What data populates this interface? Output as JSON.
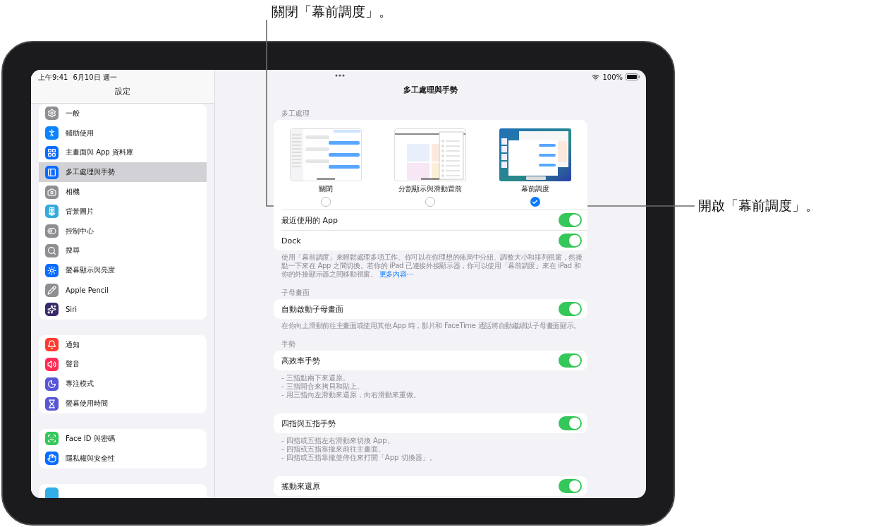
{
  "callouts": [
    {
      "text": "關閉「幕前調度」。"
    },
    {
      "text": "開啟「幕前調度」。"
    }
  ],
  "status_bar": {
    "time": "上午9:41",
    "date": "6月10日 週一",
    "battery": "100%"
  },
  "sidebar": {
    "title": "設定",
    "groups": [
      [
        {
          "label": "一般",
          "kind": "gear",
          "color": "#8e8e93",
          "selected": false
        },
        {
          "label": "輔助使用",
          "kind": "accessibility",
          "color": "#0a84ff",
          "selected": false
        },
        {
          "label": "主畫面與 App 資料庫",
          "kind": "grid",
          "color": "#0a6cff",
          "selected": false
        },
        {
          "label": "多工處理與手勢",
          "kind": "panels",
          "color": "#0a6cff",
          "selected": true
        },
        {
          "label": "相機",
          "kind": "camera",
          "color": "#8e8e93",
          "selected": false
        },
        {
          "label": "背景圖片",
          "kind": "flower",
          "color": "#35aadc",
          "selected": false
        },
        {
          "label": "控制中心",
          "kind": "toggles",
          "color": "#8e8e93",
          "selected": false
        },
        {
          "label": "搜尋",
          "kind": "search",
          "color": "#8e8e93",
          "selected": false
        },
        {
          "label": "螢幕顯示與亮度",
          "kind": "sun",
          "color": "#0a6cff",
          "selected": false
        },
        {
          "label": "Apple Pencil",
          "kind": "pencil",
          "color": "#8e8e93",
          "selected": false
        },
        {
          "label": "Siri",
          "kind": "orb",
          "color": "#3a2a6a",
          "selected": false
        }
      ],
      [
        {
          "label": "通知",
          "kind": "bell",
          "color": "#ff3b30",
          "selected": false
        },
        {
          "label": "聲音",
          "kind": "speaker",
          "color": "#ff2d55",
          "selected": false
        },
        {
          "label": "專注模式",
          "kind": "moon",
          "color": "#5856d6",
          "selected": false
        },
        {
          "label": "螢幕使用時間",
          "kind": "hourglass",
          "color": "#5856d6",
          "selected": false
        }
      ],
      [
        {
          "label": "Face ID 與密碼",
          "kind": "face",
          "color": "#34c759",
          "selected": false
        },
        {
          "label": "隱私權與安全性",
          "kind": "hand",
          "color": "#0a6cff",
          "selected": false
        }
      ],
      [
        {
          "kind": "partial",
          "color": "#32ade6"
        }
      ]
    ]
  },
  "detail": {
    "title": "多工處理與手勢",
    "sections": [
      {
        "header": "多工處理",
        "modes": [
          {
            "label": "關閉",
            "kind": "full",
            "selected": false
          },
          {
            "label": "分割顯示與滑動置前",
            "kind": "split",
            "selected": false
          },
          {
            "label": "幕前調度",
            "kind": "stage",
            "selected": true
          }
        ],
        "rows": [
          {
            "label": "最近使用的 App",
            "on": true
          },
          {
            "label": "Dock",
            "on": true
          }
        ],
        "footer": "使用「幕前調度」來輕鬆處理多項工作。你可以在你理想的佈局中分組、調整大小和排列視窗，然後點一下來在 App 之間切換。若你的 iPad 已連接外接顯示器，你可以使用「幕前調度」來在 iPad 和你的外接顯示器之間移動視窗。",
        "footer_link": "更多內容⋯"
      },
      {
        "header": "子母畫面",
        "rows": [
          {
            "label": "自動啟動子母畫面",
            "on": true
          }
        ],
        "footer": "在你向上滑動前往主畫面或使用其他 App 時，影片和 FaceTime 通話將自動繼續以子母畫面顯示。"
      },
      {
        "header": "手勢",
        "rows": [
          {
            "label": "高效率手勢",
            "on": true
          }
        ],
        "bullets": [
          "- 三指點兩下來還原。",
          "- 三指開合來拷貝和貼上。",
          "- 用三指向左滑動來還原，向右滑動來重做。"
        ]
      },
      {
        "rows": [
          {
            "label": "四指與五指手勢",
            "on": true
          }
        ],
        "bullets": [
          "- 四指或五指左右滑動來切換 App。",
          "- 四指或五指靠攏來前往主畫面。",
          "- 四指或五指靠攏並停住來打開「App 切換器」。"
        ]
      },
      {
        "rows": [
          {
            "label": "搖動來還原",
            "on": true
          }
        ]
      }
    ]
  }
}
